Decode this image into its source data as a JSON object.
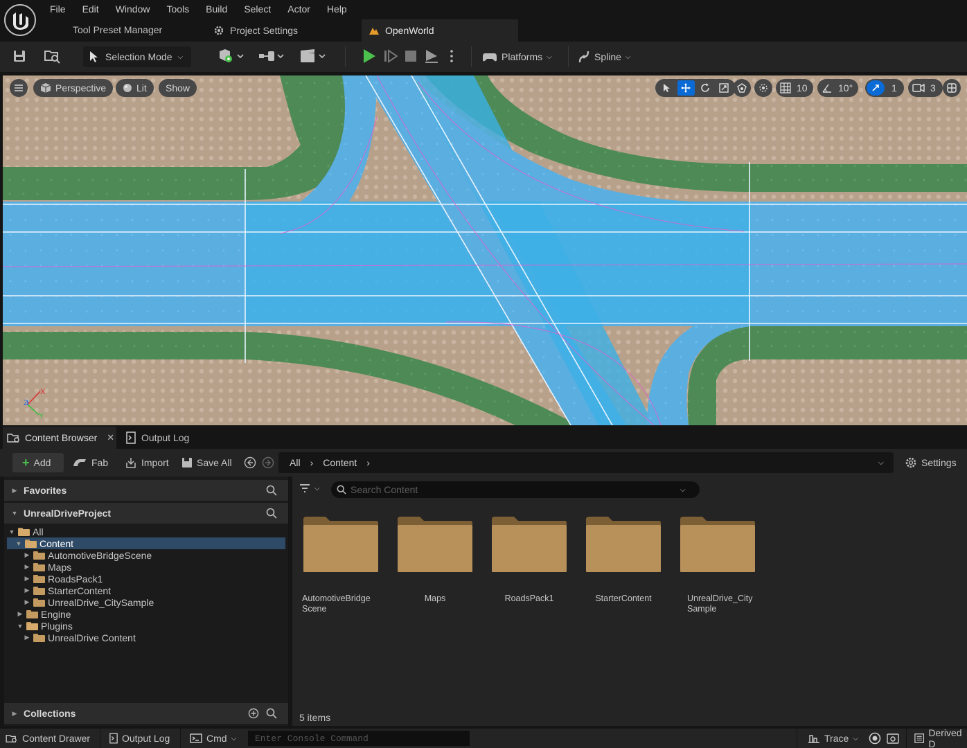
{
  "menu": [
    "File",
    "Edit",
    "Window",
    "Tools",
    "Build",
    "Select",
    "Actor",
    "Help"
  ],
  "tabs": {
    "tool_preset": "Tool Preset Manager",
    "project_settings": "Project Settings",
    "level": "OpenWorld"
  },
  "toolbar": {
    "selection_mode": "Selection Mode",
    "platforms": "Platforms",
    "spline": "Spline"
  },
  "viewport": {
    "perspective": "Perspective",
    "lit": "Lit",
    "show": "Show",
    "grid_snap": "10",
    "rotation_snap": "10°",
    "scale_snap": "1",
    "camera_speed": "3"
  },
  "content_browser": {
    "tab_label": "Content Browser",
    "output_log_tab": "Output Log",
    "add": "Add",
    "fab": "Fab",
    "import": "Import",
    "save_all": "Save All",
    "path": [
      "All",
      "Content"
    ],
    "settings": "Settings",
    "favorites": "Favorites",
    "project": "UnrealDriveProject",
    "collections": "Collections",
    "search_placeholder": "Search Content",
    "tree": {
      "all": "All",
      "content": "Content",
      "automotive": "AutomotiveBridgeScene",
      "maps": "Maps",
      "roads": "RoadsPack1",
      "starter": "StarterContent",
      "citysample": "UnrealDrive_CitySample",
      "engine": "Engine",
      "plugins": "Plugins",
      "udcontent": "UnrealDrive Content"
    },
    "assets": [
      {
        "line1": "AutomotiveBridge",
        "line2": "Scene"
      },
      {
        "line1": "Maps",
        "line2": ""
      },
      {
        "line1": "RoadsPack1",
        "line2": ""
      },
      {
        "line1": "StarterContent",
        "line2": ""
      },
      {
        "line1": "UnrealDrive_City",
        "line2": "Sample"
      }
    ],
    "items_count": "5 items"
  },
  "statusbar": {
    "content_drawer": "Content Drawer",
    "output_log": "Output Log",
    "cmd": "Cmd",
    "console_placeholder": "Enter Console Command",
    "trace": "Trace",
    "derived": "Derived D"
  },
  "colors": {
    "accent": "#0070e0",
    "play_green": "#4cc04c",
    "folder": "#c39a5f"
  }
}
